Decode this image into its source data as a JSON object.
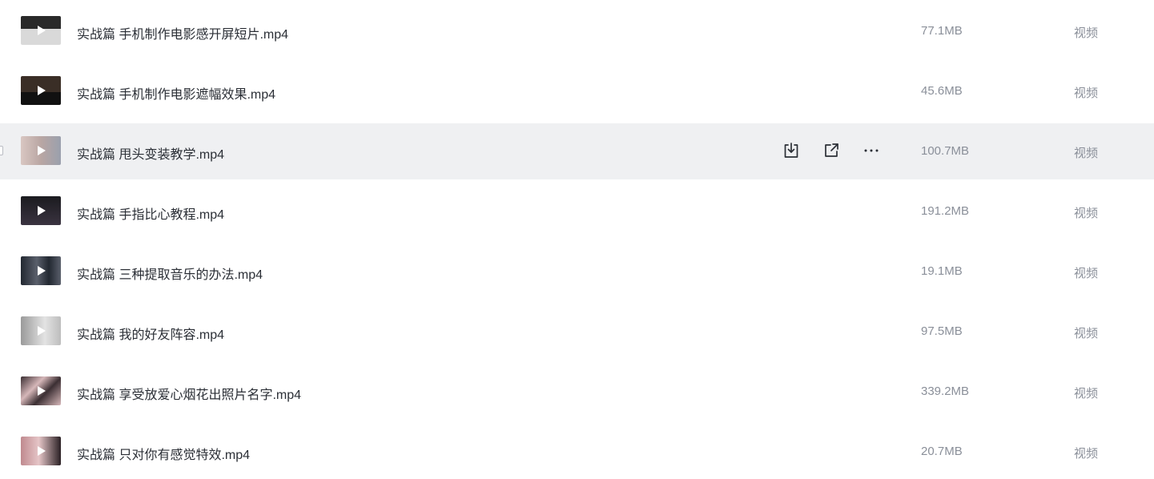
{
  "files": [
    {
      "name": "实战篇 手机制作电影感开屏短片.mp4",
      "size": "77.1MB",
      "type": "视频",
      "thumb_colors": [
        "#2a2a2a",
        "#d9d9d9"
      ]
    },
    {
      "name": "实战篇 手机制作电影遮幅效果.mp4",
      "size": "45.6MB",
      "type": "视频",
      "thumb_colors": [
        "#3a2e26",
        "#111111"
      ]
    },
    {
      "name": "实战篇 甩头变装教学.mp4",
      "size": "100.7MB",
      "type": "视频",
      "thumb_colors": [
        "#d9c7c2",
        "#9aa0ad"
      ]
    },
    {
      "name": "实战篇 手指比心教程.mp4",
      "size": "191.2MB",
      "type": "视频",
      "thumb_colors": [
        "#1b1b1f",
        "#3a3340"
      ]
    },
    {
      "name": "实战篇 三种提取音乐的办法.mp4",
      "size": "19.1MB",
      "type": "视频",
      "thumb_colors": [
        "#222831",
        "#5a5f6b"
      ]
    },
    {
      "name": "实战篇 我的好友阵容.mp4",
      "size": "97.5MB",
      "type": "视频",
      "thumb_colors": [
        "#9a9a9a",
        "#e3e3e3"
      ]
    },
    {
      "name": "实战篇 享受放爱心烟花出照片名字.mp4",
      "size": "339.2MB",
      "type": "视频",
      "thumb_colors": [
        "#3b2f33",
        "#d6b7b9"
      ]
    },
    {
      "name": "实战篇 只对你有感觉特效.mp4",
      "size": "20.7MB",
      "type": "视频",
      "thumb_colors": [
        "#c08a8f",
        "#2a2024"
      ]
    }
  ],
  "hovered_row": 2,
  "row_actions": {
    "icons": [
      "download-icon",
      "share-icon",
      "more-icon"
    ]
  },
  "colors": {
    "hover_bg": "#eff0f2",
    "name_text": "#2b2f36",
    "meta_text": "#8a8f99"
  }
}
